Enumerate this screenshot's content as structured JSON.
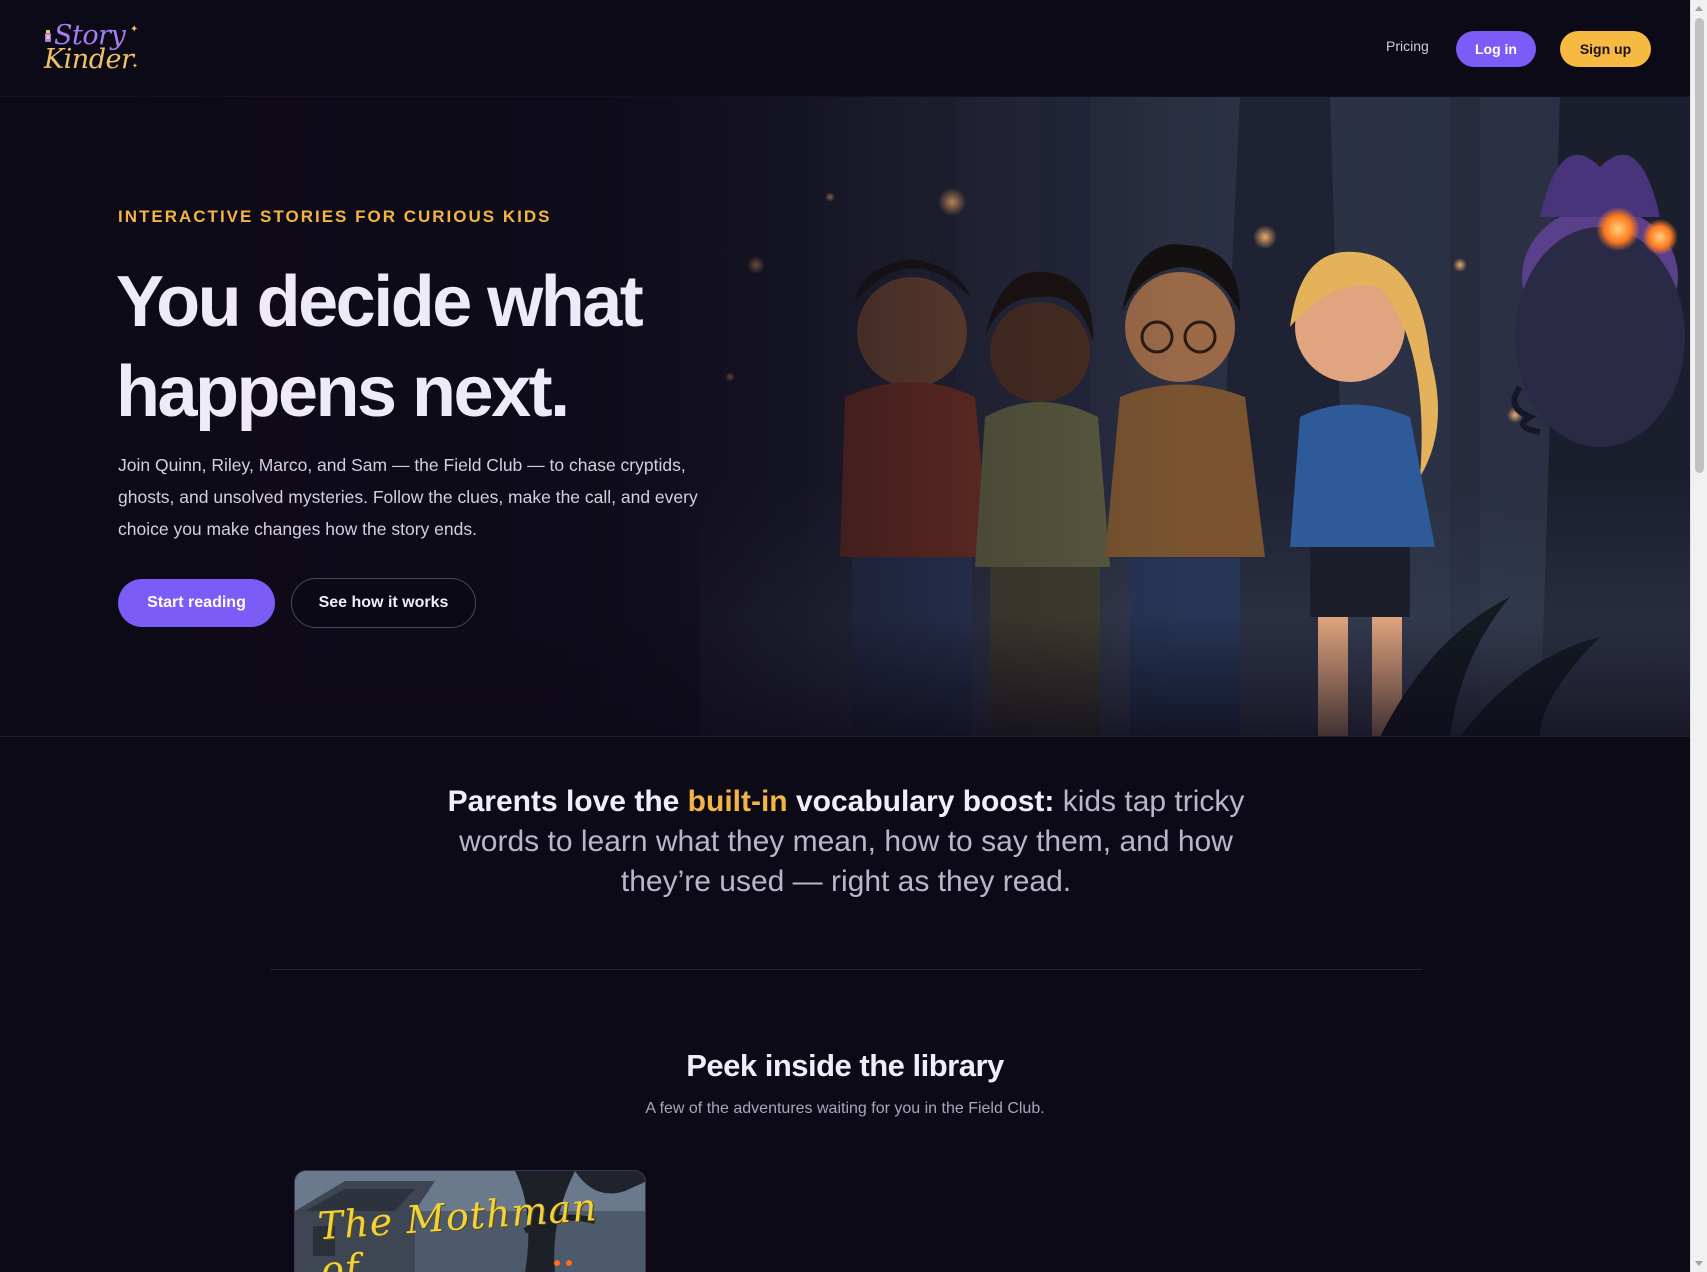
{
  "header": {
    "logo_top": "Story",
    "logo_bottom": "Kinder",
    "pricing": "Pricing",
    "login": "Log in",
    "signup": "Sign up"
  },
  "hero": {
    "eyebrow": "INTERACTIVE STORIES FOR CURIOUS KIDS",
    "title_line1": "You decide what",
    "title_line2": "happens next.",
    "description": "Join Quinn, Riley, Marco, and Sam — the Field Club — to chase cryptids, ghosts, and unsolved mysteries. Follow the clues, make the call, and every choice you make changes how the story ends.",
    "primary_cta": "Start reading",
    "secondary_cta": "See how it works"
  },
  "vocab": {
    "lead": "Parents love the ",
    "highlight": "built-in",
    "lead_end": " vocabulary boost:",
    "rest": " kids tap tricky words to learn what they mean, how to say them, and how they’re used — right as they read."
  },
  "library": {
    "title": "Peek inside the library",
    "subtitle": "A few of the adventures waiting for you in the Field Club.",
    "books": [
      {
        "cover_title": "The Mothman of"
      }
    ]
  },
  "colors": {
    "background": "#0d0a18",
    "accent_purple": "#7b5cf6",
    "accent_gold": "#f3b443"
  }
}
